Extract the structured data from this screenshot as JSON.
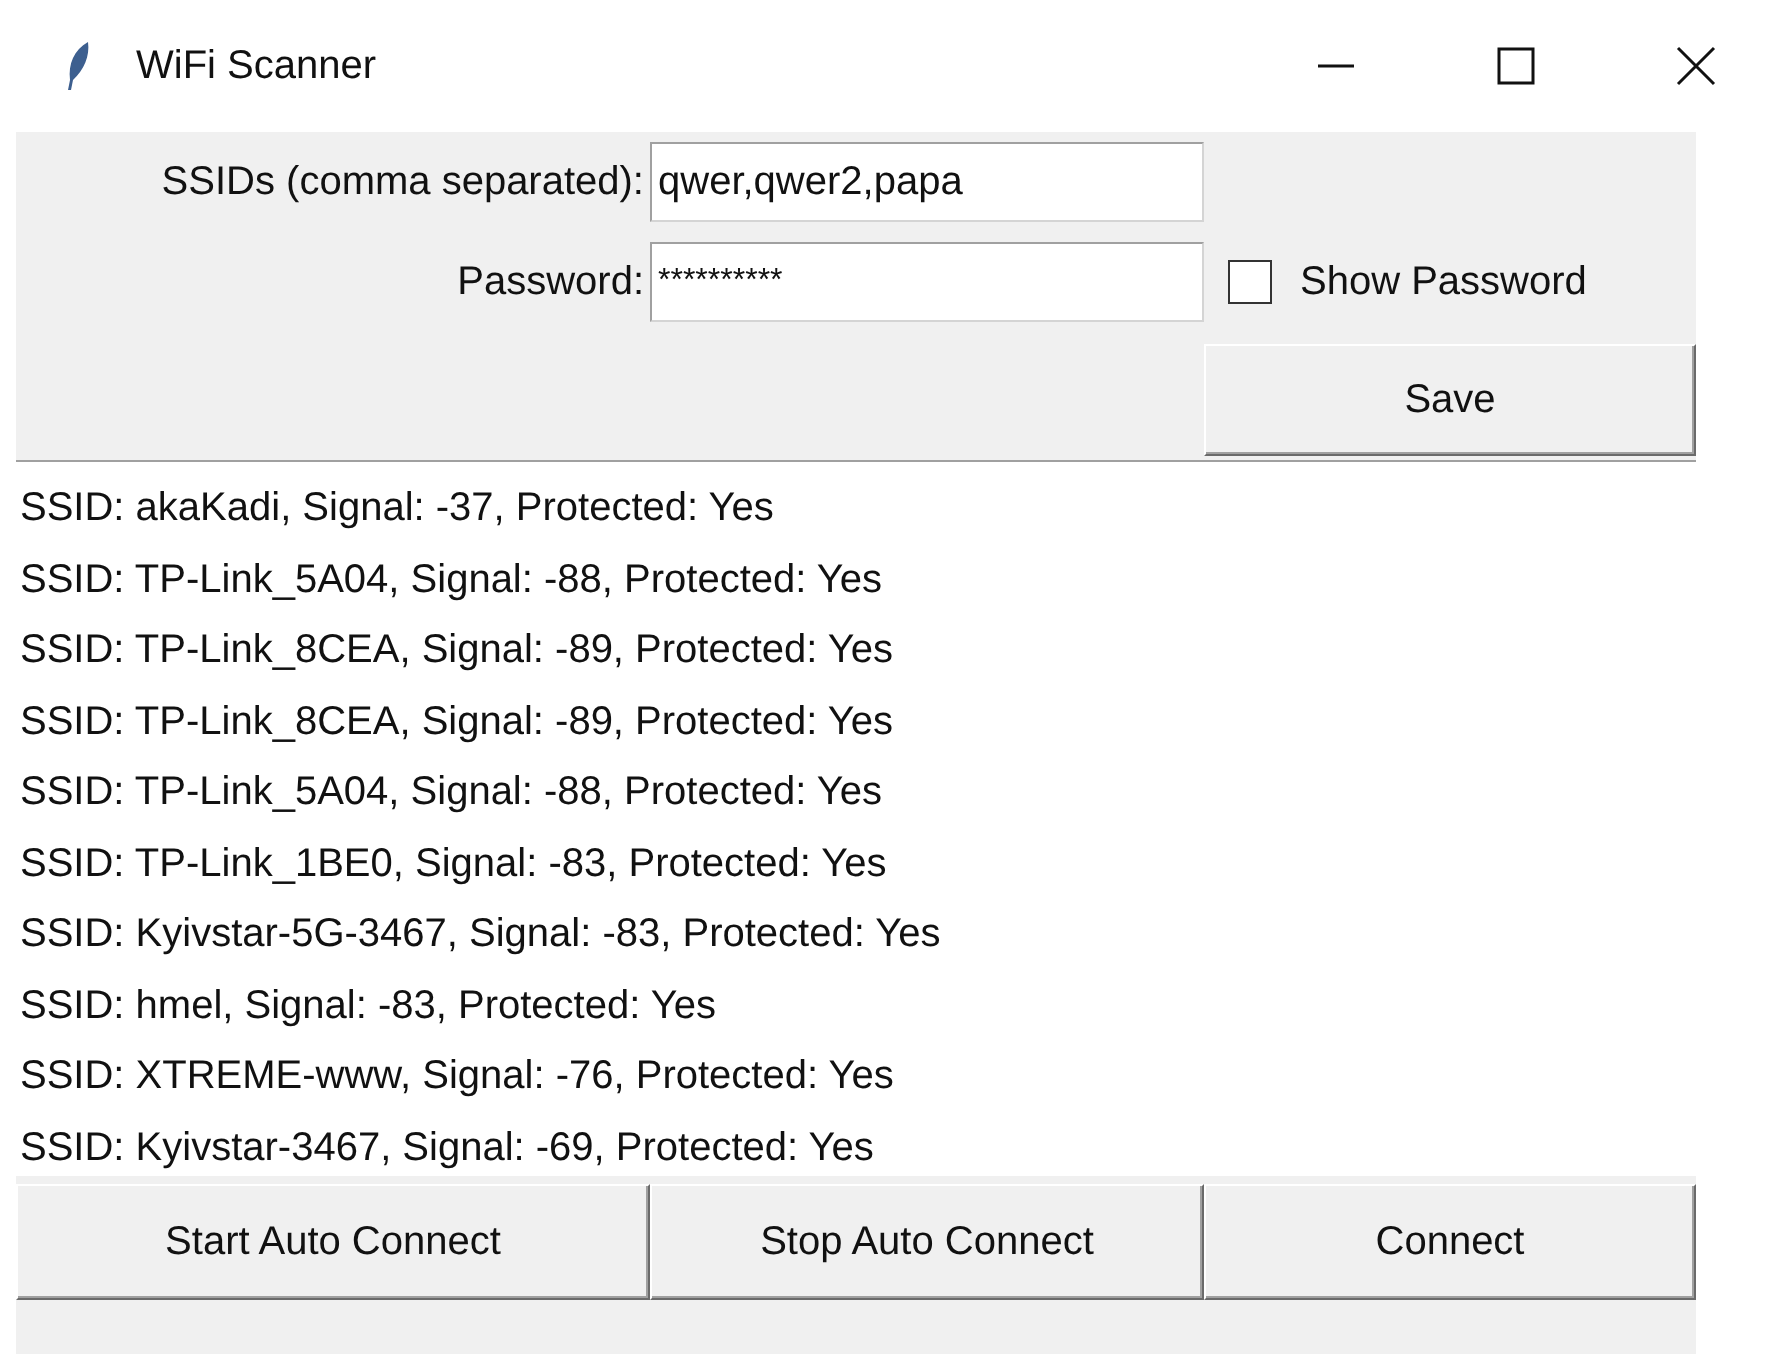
{
  "window": {
    "title": "WiFi Scanner"
  },
  "ssids": {
    "label": "SSIDs (comma separated):",
    "value": "qwer,qwer2,papa"
  },
  "password": {
    "label": "Password:",
    "value": "**********"
  },
  "show_password": {
    "label": "Show Password",
    "checked": false
  },
  "save_button": "Save",
  "networks": [
    "SSID: akaKadi, Signal: -37, Protected: Yes",
    "SSID: TP-Link_5A04, Signal: -88, Protected: Yes",
    "SSID: TP-Link_8CEA, Signal: -89, Protected: Yes",
    "SSID: TP-Link_8CEA, Signal: -89, Protected: Yes",
    "SSID: TP-Link_5A04, Signal: -88, Protected: Yes",
    "SSID: TP-Link_1BE0, Signal: -83, Protected: Yes",
    "SSID: Kyivstar-5G-3467, Signal: -83, Protected: Yes",
    "SSID: hmel, Signal: -83, Protected: Yes",
    "SSID: XTREME-www, Signal: -76, Protected: Yes",
    "SSID: Kyivstar-3467, Signal: -69, Protected: Yes"
  ],
  "buttons": [
    "Start Auto Connect",
    "Stop Auto Connect",
    "Connect"
  ]
}
